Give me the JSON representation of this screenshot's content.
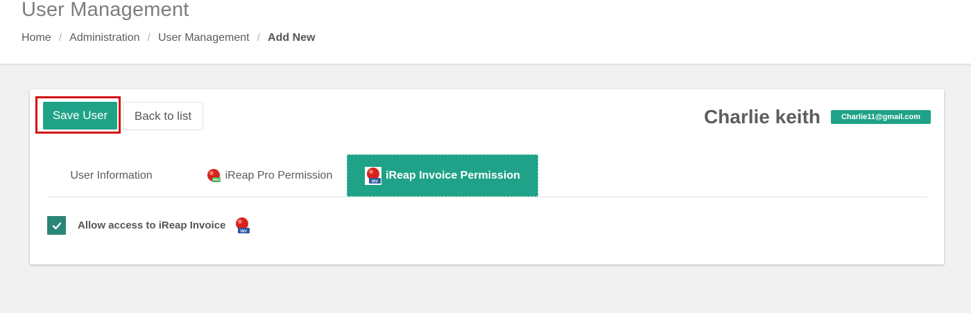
{
  "header": {
    "title": "User Management",
    "breadcrumb": [
      "Home",
      "Administration",
      "User Management",
      "Add New"
    ]
  },
  "toolbar": {
    "save_label": "Save User",
    "back_label": "Back to list"
  },
  "user": {
    "name": "Charlie keith",
    "email": "Charlie11@gmail.com"
  },
  "tabs": [
    {
      "label": "User Information",
      "active": false
    },
    {
      "label": "iReap Pro Permission",
      "active": false,
      "icon": "ireap-pro-icon"
    },
    {
      "label": "iReap Invoice Permission",
      "active": true,
      "icon": "ireap-invoice-icon"
    }
  ],
  "permissions": {
    "allow_invoice_label": "Allow access to iReap Invoice",
    "allow_invoice_checked": true
  },
  "colors": {
    "accent": "#1fa287",
    "checkbox": "#2a8677",
    "highlight": "#d20f12"
  }
}
